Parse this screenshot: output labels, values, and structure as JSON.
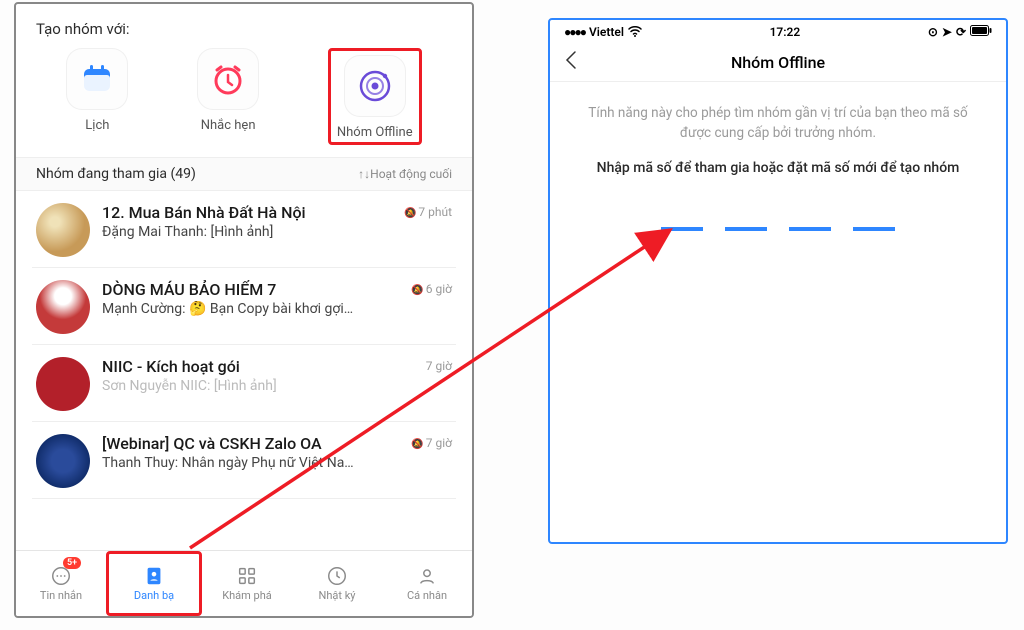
{
  "left": {
    "create_title": "Tạo nhóm với:",
    "options": {
      "calendar": "Lịch",
      "reminder": "Nhắc hẹn",
      "offline": "Nhóm Offline"
    },
    "section_title": "Nhóm đang tham gia (49)",
    "section_sort": "↑↓Hoạt động cuối",
    "groups": [
      {
        "title": "12. Mua Bán Nhà Đất Hà Nội",
        "subtitle": "Đặng Mai Thanh: [Hình ảnh]",
        "time": "7 phút",
        "muted": true
      },
      {
        "title": "DÒNG MÁU BẢO HIỂM 7",
        "subtitle": "Mạnh Cường: 🤔 Bạn Copy bài khơi gợi…",
        "time": "6 giờ",
        "muted": true
      },
      {
        "title": "NIIC - Kích hoạt gói",
        "subtitle": "Sơn Nguyễn NIIC: [Hình ảnh]",
        "time": "7 giờ",
        "muted": false,
        "grey": true
      },
      {
        "title": "[Webinar] QC và CSKH Zalo OA",
        "subtitle": "Thanh Thuy: Nhân ngày Phụ nữ Việt Na…",
        "time": "7 giờ",
        "muted": true
      }
    ],
    "tabs": {
      "messages": "Tin nhắn",
      "messages_badge": "5+",
      "contacts": "Danh bạ",
      "discover": "Khám phá",
      "diary": "Nhật ký",
      "profile": "Cá nhân"
    }
  },
  "right": {
    "carrier": "Viettel",
    "time": "17:22",
    "title": "Nhóm Offline",
    "desc1": "Tính năng này cho phép tìm nhóm gần vị trí của bạn theo mã số được cung cấp bởi trưởng nhóm.",
    "desc2": "Nhập mã số để tham gia hoặc đặt mã số mới để tạo nhóm"
  }
}
